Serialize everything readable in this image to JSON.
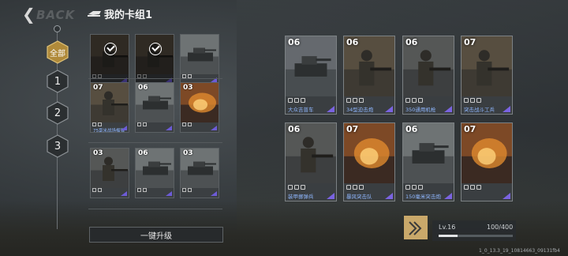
{
  "header": {
    "back_watermark": "BACK",
    "deck_title": "我的卡组1"
  },
  "tabs": [
    {
      "label": "全部",
      "active": true
    },
    {
      "label": "1",
      "active": false
    },
    {
      "label": "2",
      "active": false
    },
    {
      "label": "3",
      "active": false
    }
  ],
  "small_cards": [
    {
      "cost": "",
      "name": "",
      "selected": true,
      "art": "soldiers"
    },
    {
      "cost": "",
      "name": "",
      "selected": true,
      "art": "soldiers"
    },
    {
      "cost": "",
      "name": "",
      "selected": false,
      "art": "tank"
    },
    {
      "cost": "07",
      "name": "75毫米战场榴弹",
      "selected": false,
      "art": "soldiers"
    },
    {
      "cost": "06",
      "name": "",
      "selected": false,
      "art": "tank"
    },
    {
      "cost": "03",
      "name": "",
      "selected": false,
      "art": "fire"
    },
    {
      "cost": "03",
      "name": "",
      "selected": false,
      "art": "soldier"
    },
    {
      "cost": "06",
      "name": "",
      "selected": false,
      "art": "tank"
    },
    {
      "cost": "03",
      "name": "",
      "selected": false,
      "art": "tank"
    }
  ],
  "large_cards": [
    {
      "cost": "06",
      "name": "大众吉普车",
      "art": "vehicle"
    },
    {
      "cost": "06",
      "name": "34型迫击炮",
      "art": "soldiers"
    },
    {
      "cost": "06",
      "name": "350通用机枪",
      "art": "soldier"
    },
    {
      "cost": "07",
      "name": "突击战斗工兵",
      "art": "soldiers"
    },
    {
      "cost": "06",
      "name": "装甲掷弹兵",
      "art": "soldier"
    },
    {
      "cost": "07",
      "name": "暴风突击队",
      "art": "fire"
    },
    {
      "cost": "06",
      "name": "150毫米突击炮",
      "art": "tank"
    },
    {
      "cost": "07",
      "name": "",
      "art": "fire"
    }
  ],
  "upgrade_button": "一键升级",
  "level": {
    "label": "Lv.16",
    "current": 100,
    "max": 400,
    "count_text": "100/400"
  },
  "build": "1_0_13.3_19_10814663_09131fb4",
  "colors": {
    "name_text": "#8fb7ff",
    "rarity_corner": "#7a63e0",
    "level_icon": "#c9a86a"
  }
}
